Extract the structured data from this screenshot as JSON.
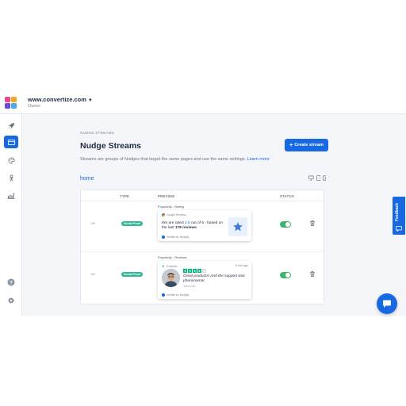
{
  "brand": {
    "site_name": "www.convertize.com",
    "site_role": "Owner",
    "logo_colors": [
      "#e94a8b",
      "#f7a823",
      "#6d4bd8",
      "#4aa8f0"
    ]
  },
  "sidebar": {
    "items": [
      {
        "icon": "rocket-icon"
      },
      {
        "icon": "streams-icon",
        "active": true
      },
      {
        "icon": "palette-icon"
      },
      {
        "icon": "person-icon"
      },
      {
        "icon": "analytics-icon"
      }
    ],
    "bottom": [
      {
        "icon": "help-icon"
      },
      {
        "icon": "gear-icon"
      }
    ]
  },
  "page": {
    "breadcrumb": "NUDGE STREAMS",
    "title": "Nudge Streams",
    "subtitle": "Streams are groups of Nudges that target the same pages and use the same settings.",
    "learn_more": "Learn more",
    "create_label": "Create stream",
    "section_name": "home"
  },
  "table": {
    "columns": {
      "type": "TYPE",
      "preview": "PREVIEW",
      "status": "STATUS"
    },
    "rows": [
      {
        "id": "188",
        "type": "Social Proof",
        "preview_label": "Popularity - Rating",
        "card": {
          "source": "Google Reviews",
          "text_before": "We are rated ",
          "rating_value": "4.5",
          "text_middle": " out of 5 - based on the last ",
          "reviews_count": "178 reviews",
          "text_after": ".",
          "verified": "Verified by Nudgify"
        },
        "active": true
      },
      {
        "id": "189",
        "type": "Social Proof",
        "preview_label": "Popularity - Reviews",
        "card": {
          "source": "Trustpilot",
          "time_ago": "6 min ago",
          "stars": 4,
          "review": "Great products! And the support was phenomenal",
          "reviewer": "Jason Day",
          "verified": "Verified by Nudgify"
        },
        "active": true
      }
    ]
  },
  "feedback_label": "Feedback",
  "colors": {
    "accent": "#1668e3",
    "badge": "#31b69c",
    "toggle_on": "#3cb371",
    "trustpilot": "#00b67a"
  }
}
